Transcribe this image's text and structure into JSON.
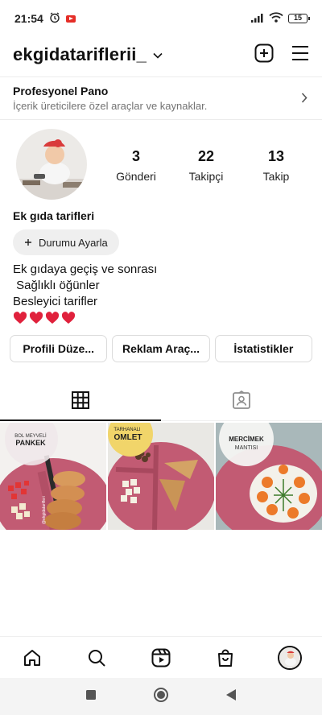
{
  "status_bar": {
    "time": "21:54",
    "battery": "15",
    "icons": [
      "alarm-icon",
      "youtube-notification-icon",
      "signal-icon",
      "wifi-icon",
      "battery-icon"
    ]
  },
  "header": {
    "username": "ekgidatariflerii_",
    "icons": [
      "chevron-down-icon",
      "create-post-icon",
      "menu-icon"
    ]
  },
  "pro_panel": {
    "title": "Profesyonel Pano",
    "subtitle": "İçerik üreticilere özel araçlar ve kaynaklar."
  },
  "stats": [
    {
      "value": "3",
      "label": "Gönderi"
    },
    {
      "value": "22",
      "label": "Takipçi"
    },
    {
      "value": "13",
      "label": "Takip"
    }
  ],
  "profile": {
    "display_name": "Ek gıda tarifleri",
    "status_button": "Durumu Ayarla",
    "bio_lines": [
      "Ek gıdaya geçiş ve sonrası",
      " Sağlıklı öğünler",
      "Besleyici tarifler"
    ],
    "hearts": "❤️❤️❤️❤️"
  },
  "actions": {
    "edit_profile": "Profili Düze...",
    "ad_tools": "Reklam Araç...",
    "insights": "İstatistikler"
  },
  "tabs": [
    "grid-tab",
    "tagged-tab"
  ],
  "posts": [
    {
      "line1": "BOL MEYVELİ",
      "line2": "PANKEK",
      "watermark": "@ekgidatarifleri"
    },
    {
      "line1": "TARHANALI",
      "line2": "OMLET"
    },
    {
      "line1": "MERCİMEK",
      "line2": "MANTISI"
    }
  ],
  "bottom_nav": [
    "home-icon",
    "search-icon",
    "reels-icon",
    "shop-icon",
    "profile-avatar"
  ],
  "colors": {
    "accent": "#111111",
    "muted_text": "#737373",
    "button_bg": "#efefef",
    "plate_pink": "#c25b73",
    "heart_red": "#e0213c"
  }
}
